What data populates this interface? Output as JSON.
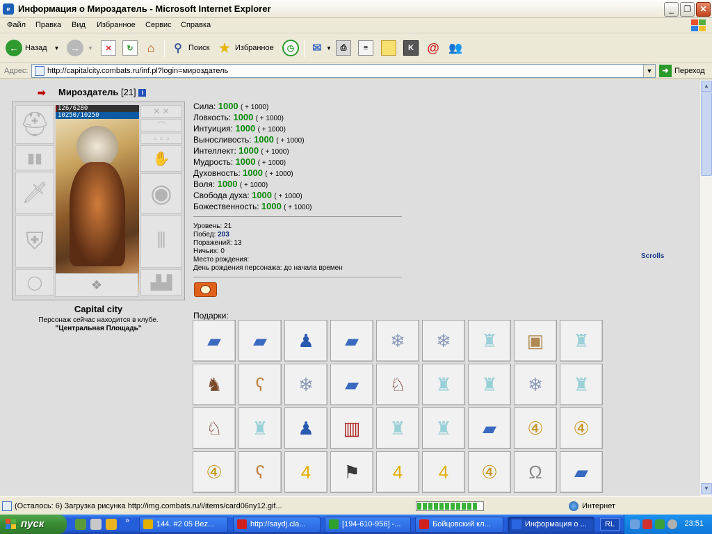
{
  "window": {
    "title": "Информация о Мироздатель - Microsoft Internet Explorer",
    "minimize_glyph": "_",
    "maximize_glyph": "❐",
    "close_glyph": "✕"
  },
  "menu": [
    "Файл",
    "Правка",
    "Вид",
    "Избранное",
    "Сервис",
    "Справка"
  ],
  "toolbar": {
    "back_label": "Назад",
    "search_label": "Поиск",
    "favorites_label": "Избранное"
  },
  "address": {
    "label": "Адрес:",
    "url": "http://capitalcity.combats.ru/inf.pl?login=мироздатель",
    "go_label": "Переход"
  },
  "character": {
    "name": "Мироздатель",
    "level_tag": "[21]",
    "hp": "126/6280",
    "hp_fraction": 0.02,
    "mana": "10250/10250",
    "city": "Capital city",
    "location_text": "Персонаж сейчас находится в клубе.",
    "room": "\"Центральная Площадь\""
  },
  "stats": [
    {
      "label": "Сила:",
      "value": "1000",
      "bonus": "( + 1000)"
    },
    {
      "label": "Ловкость:",
      "value": "1000",
      "bonus": "( + 1000)"
    },
    {
      "label": "Интуиция:",
      "value": "1000",
      "bonus": "( + 1000)"
    },
    {
      "label": "Выносливость:",
      "value": "1000",
      "bonus": "( + 1000)"
    },
    {
      "label": "Интеллект:",
      "value": "1000",
      "bonus": "( + 1000)"
    },
    {
      "label": "Мудрость:",
      "value": "1000",
      "bonus": "( + 1000)"
    },
    {
      "label": "Духовность:",
      "value": "1000",
      "bonus": "( + 1000)"
    },
    {
      "label": "Воля:",
      "value": "1000",
      "bonus": "( + 1000)"
    },
    {
      "label": "Свобода духа:",
      "value": "1000",
      "bonus": "( + 1000)"
    },
    {
      "label": "Божественность:",
      "value": "1000",
      "bonus": "( + 1000)"
    }
  ],
  "info": {
    "level": "Уровень: 21",
    "wins_label": "Побед:",
    "wins_value": "203",
    "losses": "Поражений: 13",
    "draws": "Ничьих: 0",
    "birthplace": "Место рождения:",
    "birthday": "День рождения персонажа: до начала времен"
  },
  "scrolls_label": "Scrolls",
  "gifts_label": "Подарки:",
  "gifts": [
    [
      "vaseline-tube",
      "vaseline-tube",
      "snow-maiden",
      "vaseline-tube",
      "snowflake",
      "snowflake",
      "ice-tower",
      "paper-bag",
      "ice-tower"
    ],
    [
      "armored-beast",
      "teddy-bear",
      "snowflake",
      "vaseline-tube",
      "rocking-horse",
      "ice-tower",
      "ice-tower",
      "snowflake",
      "ice-tower"
    ],
    [
      "rocking-horse",
      "ice-tower",
      "snow-maiden",
      "chocolate-bar",
      "ice-tower",
      "ice-tower",
      "vaseline-tube",
      "gold-medal-4",
      "gold-medal-4"
    ],
    [
      "gold-medal-4",
      "teddy-bear",
      "gold-cup-4",
      "dark-banner",
      "gold-cup-4",
      "gold-cup-4",
      "gold-medal-4",
      "horseshoe",
      "vaseline-tube"
    ]
  ],
  "statusbar": {
    "text": "(Осталось: 6) Загрузка рисунка http://img.combats.ru/i/items/card06ny12.gif...",
    "progress": 0.92,
    "zone": "Интернет"
  },
  "taskbar": {
    "start_label": "пуск",
    "tasks": [
      {
        "label": "144. #2 05 Bez...",
        "color": "#e0b000"
      },
      {
        "label": "http://saydj.cla...",
        "color": "#d02020"
      },
      {
        "label": "[194-610-956] -...",
        "color": "#30a030"
      },
      {
        "label": "Бойцовский кл...",
        "color": "#d02020"
      },
      {
        "label": "Информация о ...",
        "color": "#2a66df"
      }
    ],
    "language": "RL",
    "clock": "23:51"
  },
  "colors": {
    "stat_value": "#0a8a0a",
    "wins_value": "#0a2e7a",
    "content_bg": "#dedede",
    "taskbar": "#245edb"
  }
}
